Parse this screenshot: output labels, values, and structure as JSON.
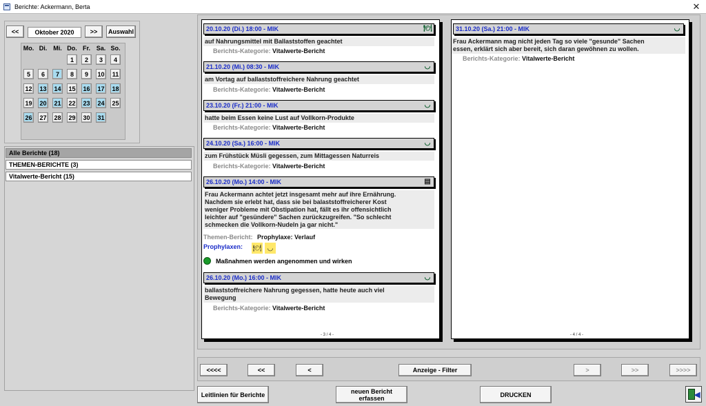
{
  "window": {
    "title": "Berichte: Ackermann, Berta"
  },
  "calendar": {
    "prev_label": "<<",
    "month_label": "Oktober 2020",
    "next_label": ">>",
    "select_label": "Auswahl",
    "weekdays": [
      "Mo.",
      "Di.",
      "Mi.",
      "Do.",
      "Fr.",
      "Sa.",
      "So."
    ],
    "days": [
      {
        "d": "1",
        "hl": false
      },
      {
        "d": "2",
        "hl": false
      },
      {
        "d": "3",
        "hl": false
      },
      {
        "d": "4",
        "hl": false
      },
      {
        "d": "5",
        "hl": false
      },
      {
        "d": "6",
        "hl": false
      },
      {
        "d": "7",
        "hl": true
      },
      {
        "d": "8",
        "hl": false
      },
      {
        "d": "9",
        "hl": false
      },
      {
        "d": "10",
        "hl": false
      },
      {
        "d": "11",
        "hl": false
      },
      {
        "d": "12",
        "hl": false
      },
      {
        "d": "13",
        "hl": true
      },
      {
        "d": "14",
        "hl": true
      },
      {
        "d": "15",
        "hl": false
      },
      {
        "d": "16",
        "hl": true
      },
      {
        "d": "17",
        "hl": true
      },
      {
        "d": "18",
        "hl": true
      },
      {
        "d": "19",
        "hl": false
      },
      {
        "d": "20",
        "hl": true
      },
      {
        "d": "21",
        "hl": true
      },
      {
        "d": "22",
        "hl": false
      },
      {
        "d": "23",
        "hl": true
      },
      {
        "d": "24",
        "hl": true
      },
      {
        "d": "25",
        "hl": false
      },
      {
        "d": "26",
        "hl": true
      },
      {
        "d": "27",
        "hl": false
      },
      {
        "d": "28",
        "hl": false
      },
      {
        "d": "29",
        "hl": false
      },
      {
        "d": "30",
        "hl": false
      },
      {
        "d": "31",
        "hl": true
      }
    ]
  },
  "report_list": {
    "items": [
      {
        "label": "Alle Berichte (18)",
        "selected": true
      },
      {
        "label": "THEMEN-BERICHTE (3)",
        "selected": false
      },
      {
        "label": "Vitalwerte-Bericht (15)",
        "selected": false
      }
    ]
  },
  "page_left": {
    "number": "- 3 / 4 -",
    "entries": [
      {
        "header": "20.10.20 (Di.) 18:00 - MIK",
        "icon": "meal-icon",
        "text": "auf Nahrungsmittel mit Ballaststoffen geachtet",
        "cat_label": "Berichts-Kategorie:",
        "cat_value": "Vitalwerte-Bericht"
      },
      {
        "header": "21.10.20 (Mi.) 08:30 - MIK",
        "icon": "bowl-icon",
        "text": "am Vortag auf ballaststoffreichere Nahrung geachtet",
        "cat_label": "Berichts-Kategorie:",
        "cat_value": "Vitalwerte-Bericht"
      },
      {
        "header": "23.10.20 (Fr.) 21:00 - MIK",
        "icon": "bowl-icon",
        "text": "hatte beim Essen keine Lust auf Vollkorn-Produkte",
        "cat_label": "Berichts-Kategorie:",
        "cat_value": "Vitalwerte-Bericht"
      },
      {
        "header": "24.10.20 (Sa.) 16:00 - MIK",
        "icon": "bowl-icon",
        "text": "zum Frühstück Müsli gegessen, zum Mittagessen Naturreis",
        "cat_label": "Berichts-Kategorie:",
        "cat_value": "Vitalwerte-Bericht"
      }
    ],
    "theme_entry": {
      "header": "26.10.20 (Mo.) 14:00 - MIK",
      "icon": "clipboard-icon",
      "text": "Frau Ackermann achtet jetzt insgesamt mehr auf ihre Ernährung.\nNachdem sie erlebt hat, dass sie bei balaststoffreicherer Kost\nweniger Probleme mit Obstipation hat, fällt es ihr offensichtlich\nleichter auf \"gesündere\" Sachen zurückzugreifen. \"So schlecht\nschmecken die Vollkorn-Nudeln ja gar nicht.\"",
      "theme_label": "Themen-Bericht:",
      "theme_value": "Prophylaxe: Verlauf",
      "prophylaxe_label": "Prophylaxen:",
      "status_text": "Maßnahmen werden angenommen und wirken",
      "colors": {
        "prophylaxe": "#1a2cc8",
        "status": "#1a9a2a"
      }
    },
    "last_entry": {
      "header": "26.10.20 (Mo.) 16:00 - MIK",
      "icon": "bowl-icon",
      "text": "ballaststoffreichere Nahrung gegessen, hatte heute auch viel\nBewegung",
      "cat_label": "Berichts-Kategorie:",
      "cat_value": "Vitalwerte-Bericht"
    }
  },
  "page_right": {
    "number": "- 4 / 4 -",
    "entry": {
      "header": "31.10.20 (Sa.) 21:00 - MIK",
      "icon": "bowl-icon",
      "text": "Frau Ackermann mag nicht jeden Tag so viele \"gesunde\" Sachen\nessen, erklärt sich aber bereit, sich daran gewöhnen zu wollen.",
      "cat_label": "Berichts-Kategorie:",
      "cat_value": "Vitalwerte-Bericht"
    }
  },
  "nav": {
    "first": "<<<<",
    "prev_fast": "<<",
    "prev": "<",
    "filter": "Anzeige - Filter",
    "next": ">",
    "next_fast": ">>",
    "last": ">>>>"
  },
  "footer": {
    "guidelines": "Leitlinien für Berichte",
    "new_report_1": "neuen Bericht",
    "new_report_2": "erfassen",
    "print": "DRUCKEN"
  }
}
